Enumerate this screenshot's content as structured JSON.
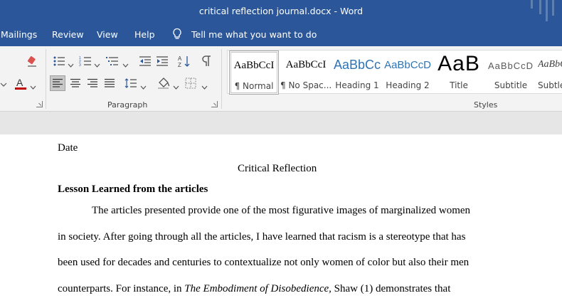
{
  "window": {
    "title": "critical reflection journal.docx  -  Word"
  },
  "menu": {
    "items": [
      "Mailings",
      "Review",
      "View",
      "Help"
    ],
    "tell_me": "Tell me what you want to do"
  },
  "ribbon": {
    "paragraph_label": "Paragraph",
    "styles_label": "Styles",
    "styles": [
      {
        "sample": "AaBbCcI",
        "name": "¶ Normal",
        "color": "#000000"
      },
      {
        "sample": "AaBbCcI",
        "name": "¶ No Spac...",
        "color": "#000000"
      },
      {
        "sample": "AaBbCc",
        "name": "Heading 1",
        "color": "#2e74b5"
      },
      {
        "sample": "AaBbCcD",
        "name": "Heading 2",
        "color": "#2e74b5"
      },
      {
        "sample": "AaB",
        "name": "Title",
        "color": "#000000"
      },
      {
        "sample": "AaBbCcD",
        "name": "Subtitle",
        "color": "#595959"
      },
      {
        "sample": "AaBbCc",
        "name": "Subtle",
        "color": "#404040"
      }
    ]
  },
  "document": {
    "date": "Date",
    "title": "Critical Reflection",
    "heading": "Lesson Learned from the articles",
    "lines": [
      "The articles presented provide one of the most figurative images of marginalized women",
      "in society. After going through all the articles, I have learned that racism is a stereotype that has",
      "been used for decades and centuries to contextualize not only women of color but also their men"
    ],
    "last_line": {
      "before": "counterparts. For instance, in ",
      "italic": "The Embodiment of Disobedience,",
      "after": " Shaw (1) demonstrates that"
    }
  },
  "colors": {
    "accent": "#2b579a",
    "font_color_bar": "#c00000"
  }
}
